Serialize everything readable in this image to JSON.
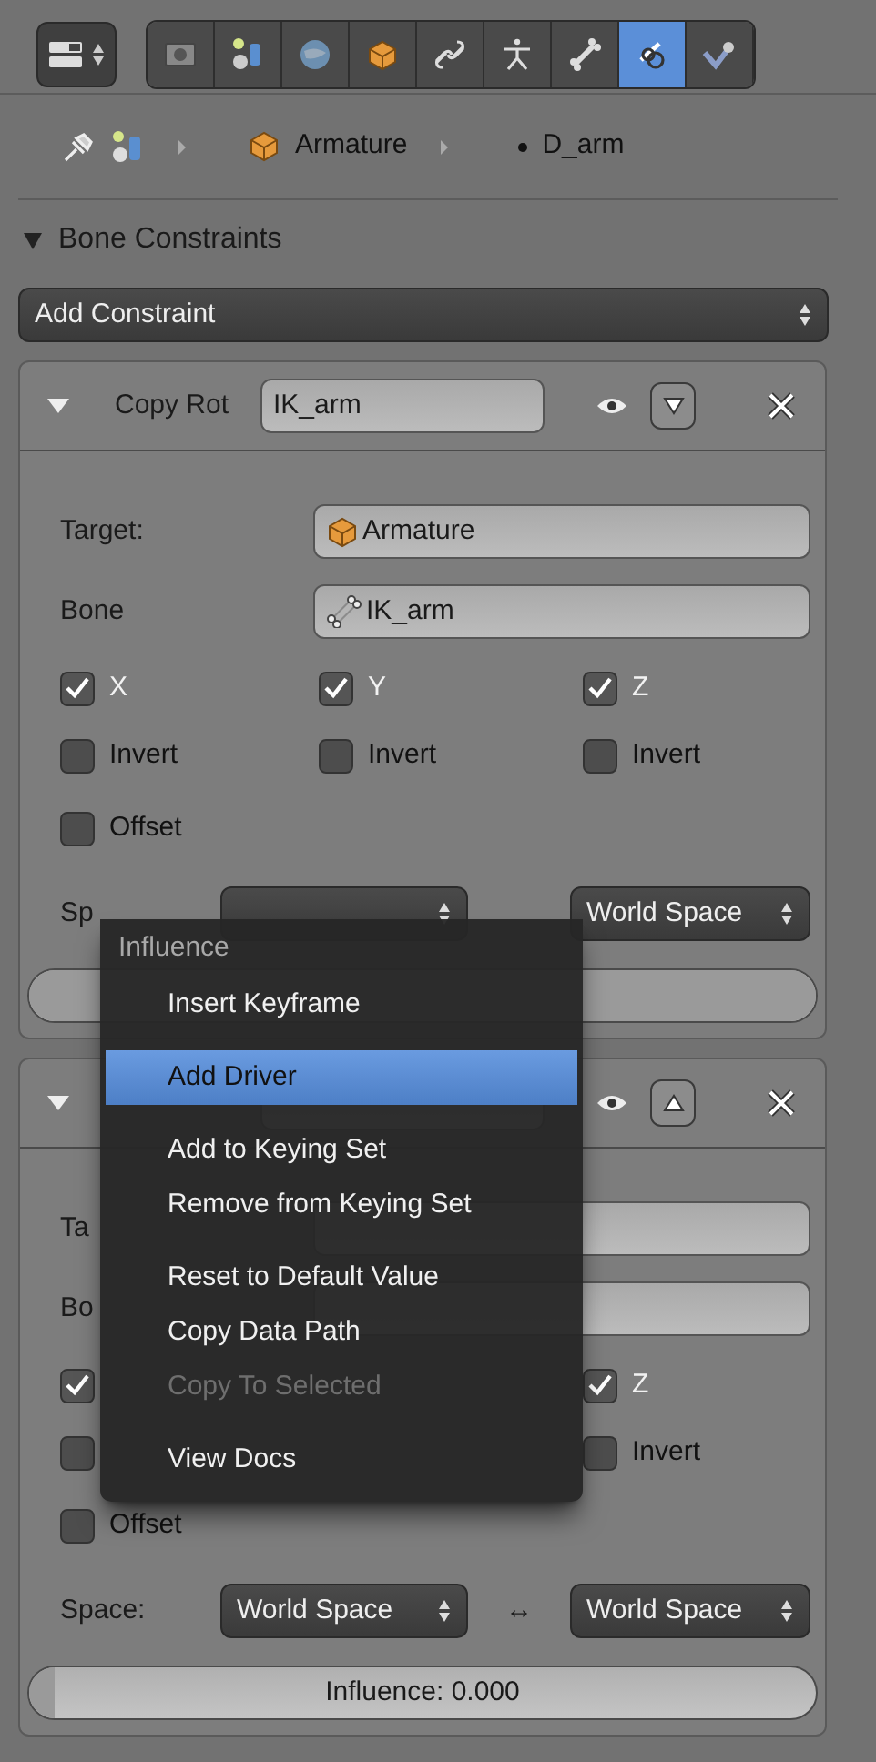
{
  "tabs": [
    {
      "selected": false
    },
    {
      "selected": false
    },
    {
      "selected": false
    },
    {
      "selected": false
    },
    {
      "selected": false
    },
    {
      "selected": false
    },
    {
      "selected": false
    },
    {
      "selected": true
    },
    {
      "selected": false
    }
  ],
  "breadcrumb": [
    "Armature",
    "D_arm"
  ],
  "panel": {
    "title": "Bone Constraints",
    "expanded": true
  },
  "add_constraint": "Add Constraint",
  "constraints": [
    {
      "expanded": true,
      "type_label": "Copy Rot",
      "name": "IK_arm",
      "move_up": false,
      "target_label": "Target:",
      "target": "Armature",
      "bone_label": "Bone",
      "bone": "IK_arm",
      "axes": {
        "x": {
          "label": "X",
          "checked": true
        },
        "y": {
          "label": "Y",
          "checked": true
        },
        "z": {
          "label": "Z",
          "checked": true
        }
      },
      "inverts": {
        "x": {
          "label": "Invert",
          "checked": false
        },
        "y": {
          "label": "Invert",
          "checked": false
        },
        "z": {
          "label": "Invert",
          "checked": false
        }
      },
      "offset": {
        "label": "Offset",
        "checked": false
      },
      "space_label": "Sp",
      "space_to": "World Space",
      "influence": {
        "level": 1
      }
    },
    {
      "expanded": true,
      "move_up": true,
      "target_label": "Ta",
      "bone_label": "Bo",
      "axes": {
        "x": {
          "checked": true
        },
        "z": {
          "label": "Z",
          "checked": true
        }
      },
      "inverts": {
        "x": {
          "checked": false
        },
        "z": {
          "label": "Invert",
          "checked": false
        }
      },
      "offset": {
        "label": "Offset",
        "checked": false
      },
      "space_label": "Space:",
      "space_from": "World Space",
      "space_arrow": "↔",
      "space_to": "World Space",
      "influence": {
        "label": "Influence: 0.000",
        "level": 0
      }
    }
  ],
  "menu": {
    "title": "Influence",
    "items": [
      {
        "kind": "item",
        "label": "Insert Keyframe",
        "selected": false,
        "disabled": false
      },
      {
        "kind": "separator"
      },
      {
        "kind": "item",
        "label": "Add Driver",
        "selected": true,
        "disabled": false
      },
      {
        "kind": "separator"
      },
      {
        "kind": "item",
        "label": "Add to Keying Set",
        "selected": false,
        "disabled": false
      },
      {
        "kind": "item",
        "label": "Remove from Keying Set",
        "selected": false,
        "disabled": false
      },
      {
        "kind": "separator"
      },
      {
        "kind": "item",
        "label": "Reset to Default Value",
        "selected": false,
        "disabled": false
      },
      {
        "kind": "item",
        "label": "Copy Data Path",
        "selected": false,
        "disabled": false
      },
      {
        "kind": "item",
        "label": "Copy To Selected",
        "selected": false,
        "disabled": true
      },
      {
        "kind": "separator"
      },
      {
        "kind": "item",
        "label": "View Docs",
        "selected": false,
        "disabled": false
      }
    ]
  }
}
